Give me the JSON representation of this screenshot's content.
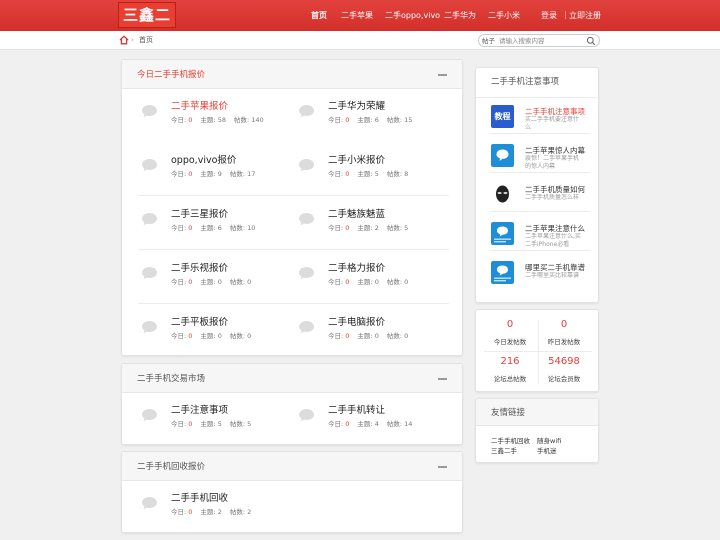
{
  "header": {
    "logo_text": "三鑫二手",
    "nav": [
      "首页",
      "二手苹果",
      "二手oppo,vivo",
      "二手华为",
      "二手小米"
    ],
    "login": "登录",
    "register": "立即注册",
    "separator": "|"
  },
  "breadcrumb": {
    "arrow": "›",
    "current": "首页"
  },
  "search": {
    "type": "帖子",
    "placeholder": "请输入搜索内容"
  },
  "stat_labels": {
    "today": "今日:",
    "topics": "主题:",
    "posts": "帖数:"
  },
  "sections": [
    {
      "title": "今日二手手机报价",
      "forums": [
        {
          "name": "二手苹果报价",
          "today": "0",
          "topics": "58",
          "posts": "140"
        },
        {
          "name": "二手华为荣耀",
          "today": "0",
          "topics": "6",
          "posts": "15"
        },
        {
          "name": "oppo,vivo报价",
          "today": "0",
          "topics": "9",
          "posts": "17"
        },
        {
          "name": "二手小米报价",
          "today": "0",
          "topics": "5",
          "posts": "8"
        },
        {
          "name": "二手三星报价",
          "today": "0",
          "topics": "6",
          "posts": "10"
        },
        {
          "name": "二手魅族魅蓝",
          "today": "0",
          "topics": "2",
          "posts": "5"
        },
        {
          "name": "二手乐视报价",
          "today": "0",
          "topics": "0",
          "posts": "0"
        },
        {
          "name": "二手格力报价",
          "today": "0",
          "topics": "0",
          "posts": "0"
        },
        {
          "name": "二手平板报价",
          "today": "0",
          "topics": "0",
          "posts": "0"
        },
        {
          "name": "二手电脑报价",
          "today": "0",
          "topics": "0",
          "posts": "0"
        }
      ]
    },
    {
      "title": "二手手机交易市场",
      "forums": [
        {
          "name": "二手注意事项",
          "today": "0",
          "topics": "5",
          "posts": "5"
        },
        {
          "name": "二手手机转让",
          "today": "0",
          "topics": "4",
          "posts": "14"
        }
      ]
    },
    {
      "title": "二手手机回收报价",
      "forums": [
        {
          "name": "二手手机回收",
          "today": "0",
          "topics": "2",
          "posts": "2"
        }
      ]
    }
  ],
  "sidebar": {
    "tips_title": "二手手机注意事项",
    "tips": [
      {
        "thumb": "教程",
        "title": "二手手机注意事项",
        "desc": "买二手手机要注意什么"
      },
      {
        "title": "二手苹果惊人内幕",
        "desc": "震惊！二手苹果手机的惊人内幕"
      },
      {
        "title": "二手手机质量如何",
        "desc": "二手手机质量怎么样"
      },
      {
        "title": "二手苹果注意什么",
        "desc": "二手苹果注意什么,买二手iPhone必看"
      },
      {
        "title": "哪里买二手机靠谱",
        "desc": "二手哪里买比较靠谱"
      }
    ],
    "stats": [
      {
        "value": "0",
        "label": "今日发帖数"
      },
      {
        "value": "0",
        "label": "昨日发帖数"
      },
      {
        "value": "216",
        "label": "论坛总帖数"
      },
      {
        "value": "54698",
        "label": "论坛会员数"
      }
    ],
    "links_title": "友情链接",
    "links": [
      "二手手机回收",
      "随身wifi",
      "三鑫二手",
      "手机迷"
    ]
  },
  "colors": {
    "brand_red": "#d63631",
    "accent_red": "#e83d35"
  }
}
